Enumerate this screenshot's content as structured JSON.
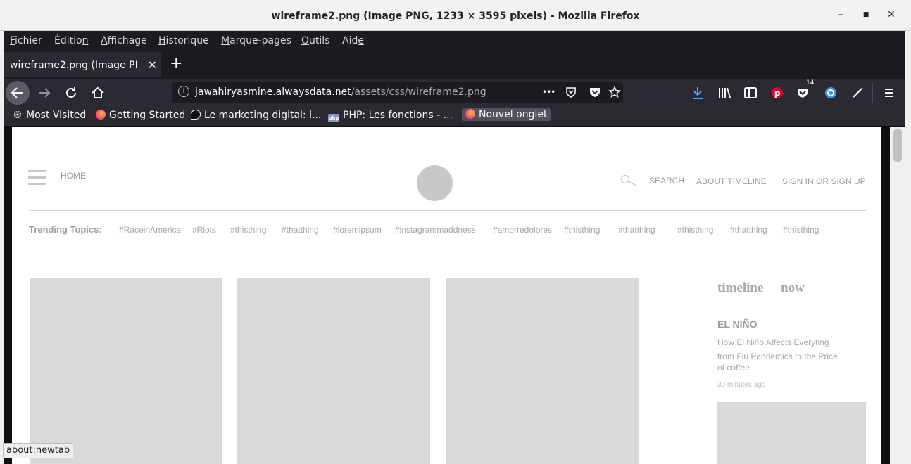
{
  "window": {
    "title": "wireframe2.png (Image PNG, 1233 × 3595 pixels) - Mozilla Firefox",
    "minimize": "‒",
    "maximize": "■",
    "close": "✕"
  },
  "menu": [
    {
      "pre": "",
      "u": "F",
      "post": "ichier"
    },
    {
      "pre": "Éditio",
      "u": "n",
      "post": ""
    },
    {
      "pre": "",
      "u": "A",
      "post": "ffichage"
    },
    {
      "pre": "",
      "u": "H",
      "post": "istorique"
    },
    {
      "pre": "",
      "u": "M",
      "post": "arque-pages"
    },
    {
      "pre": "",
      "u": "O",
      "post": "utils"
    },
    {
      "pre": "Aid",
      "u": "e",
      "post": ""
    }
  ],
  "tab": {
    "label": "wireframe2.png (Image PNG, 1233 × 3595 pixels)",
    "close": "✕",
    "new": "+"
  },
  "nav": {
    "url_host": "jawahiryasmine.alwaysdata.net",
    "url_path": "/assets/css/wireframe2.png",
    "page_actions": "•••",
    "pocket_badge": "14"
  },
  "bookmarks": [
    {
      "label": "Most Visited",
      "icon": "gear-icon"
    },
    {
      "label": "Getting Started",
      "icon": "firefox-icon"
    },
    {
      "label": "Le marketing digital: l...",
      "icon": "bookmark-icon"
    },
    {
      "label": "PHP: Les fonctions - ...",
      "icon": "php-icon"
    },
    {
      "label": "Nouvel onglet",
      "icon": "firefox-icon"
    }
  ],
  "wireframe": {
    "home": "HOME",
    "search": "SEARCH",
    "about": "ABOUT TIMELINE",
    "signin": "SIGN IN OR SIGN UP",
    "trending_label": "Trending Topics:",
    "topics": [
      "#RaceinAmerica",
      "#Riots",
      "#thisthing",
      "#thatthing",
      "#loremipsum",
      "#instagrammaddness",
      "#amorredolores",
      "#thisthing",
      "#thatthing",
      "#thisthing",
      "#thatthing",
      "#thisthing"
    ],
    "timeline_word": "timeline",
    "now_word": "now",
    "story_title": "EL NIÑO",
    "story_line1": "How El Niño Affects Everyting",
    "story_line2": "from Flu Pandemics to the Price",
    "story_line3": "of coffee",
    "story_time": "30 minutes ago"
  },
  "status": "about:newtab"
}
